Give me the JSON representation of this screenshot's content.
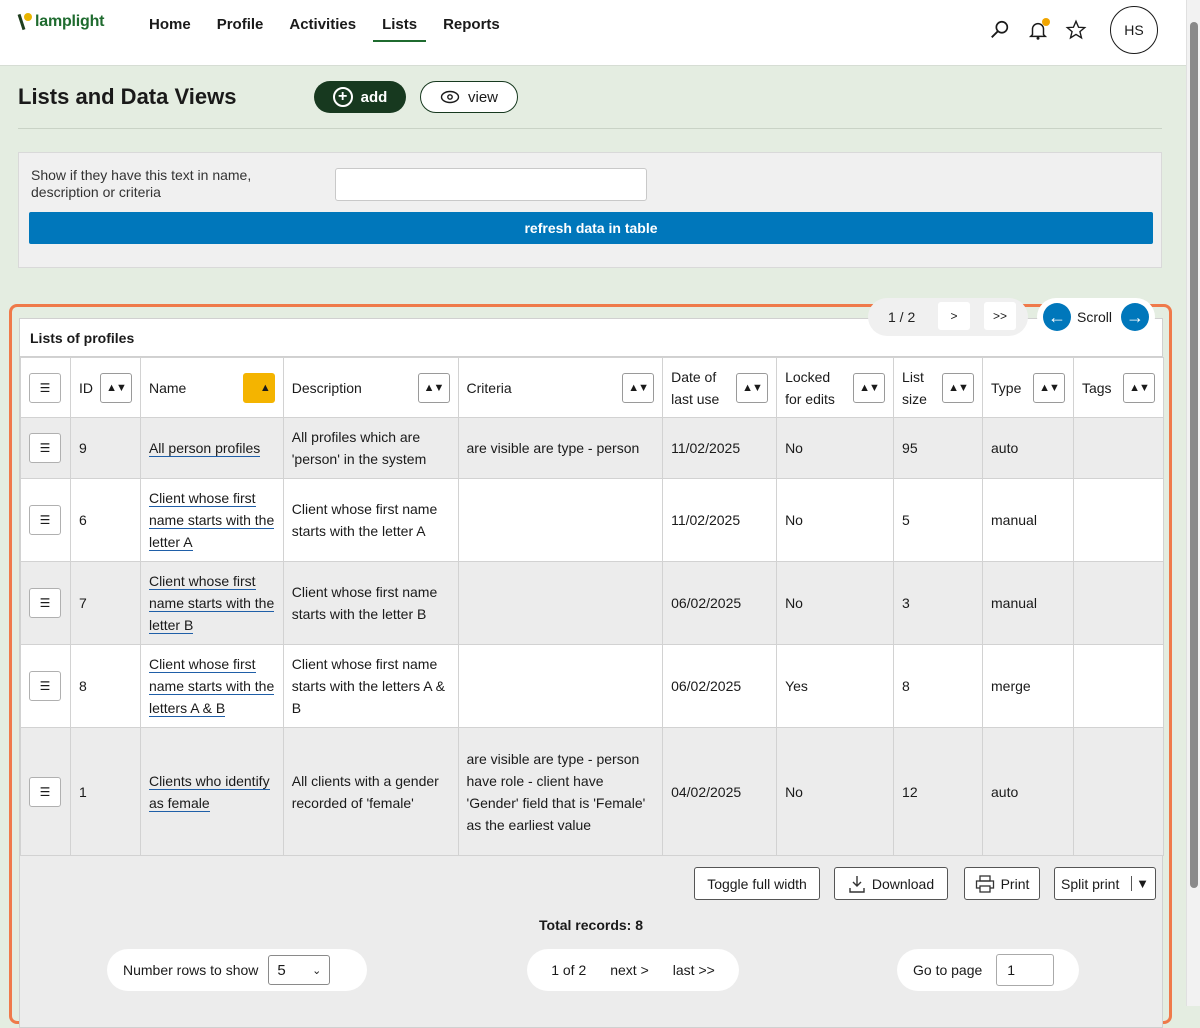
{
  "app": {
    "logo_text": "lamplight",
    "avatar_initials": "HS"
  },
  "nav": [
    {
      "label": "Home"
    },
    {
      "label": "Profile"
    },
    {
      "label": "Activities"
    },
    {
      "label": "Lists",
      "active": true
    },
    {
      "label": "Reports"
    }
  ],
  "top_icons": [
    "search-icon",
    "bell-icon",
    "star-icon"
  ],
  "page": {
    "title": "Lists and Data Views",
    "add_label": "add",
    "view_label": "view"
  },
  "filter": {
    "label": "Show if they have this text in name, description or criteria",
    "value": "",
    "refresh_label": "refresh data in table"
  },
  "table": {
    "title": "Lists of profiles",
    "page_indicator": "1 / 2",
    "next_label": ">",
    "last_label": ">>",
    "scroll_label": "Scroll",
    "columns": [
      "ID",
      "Name",
      "Description",
      "Criteria",
      "Date of last use",
      "Locked for edits",
      "List size",
      "Type",
      "Tags"
    ],
    "sorted_column": "Name",
    "rows": [
      {
        "id": "9",
        "name": "All person profiles",
        "description": "All profiles which are 'person' in the system",
        "criteria": "are visible are type - person",
        "date": "11/02/2025",
        "locked": "No",
        "size": "95",
        "type": "auto",
        "tags": ""
      },
      {
        "id": "6",
        "name": "Client whose first name starts with the letter A",
        "description": "Client whose first name starts with the letter A",
        "criteria": "",
        "date": "11/02/2025",
        "locked": "No",
        "size": "5",
        "type": "manual",
        "tags": ""
      },
      {
        "id": "7",
        "name": "Client whose first name starts with the letter B",
        "description": "Client whose first name starts with the letter B",
        "criteria": "",
        "date": "06/02/2025",
        "locked": "No",
        "size": "3",
        "type": "manual",
        "tags": ""
      },
      {
        "id": "8",
        "name": "Client whose first name starts with the letters A & B",
        "description": "Client whose first name starts with the letters A & B",
        "criteria": "",
        "date": "06/02/2025",
        "locked": "Yes",
        "size": "8",
        "type": "merge",
        "tags": ""
      },
      {
        "id": "1",
        "name": "Clients who identify as female",
        "description": "All clients with a gender recorded of 'female'",
        "criteria": "are visible are type - person have role - client have 'Gender' field that is 'Female' as the earliest value",
        "date": "04/02/2025",
        "locked": "No",
        "size": "12",
        "type": "auto",
        "tags": ""
      }
    ]
  },
  "footer": {
    "toggle_label": "Toggle full width",
    "download_label": "Download",
    "print_label": "Print",
    "split_print_label": "Split print",
    "total_label": "Total records: 8",
    "rows_label": "Number rows to show",
    "rows_value": "5",
    "page_of": "1 of 2",
    "next_link": "next >",
    "last_link": "last >>",
    "goto_label": "Go to page",
    "goto_value": "1"
  },
  "colors": {
    "brand_green": "#17391f",
    "primary_blue": "#0077bb",
    "highlight_border": "#ef7a4a",
    "sort_active": "#f4b400"
  }
}
